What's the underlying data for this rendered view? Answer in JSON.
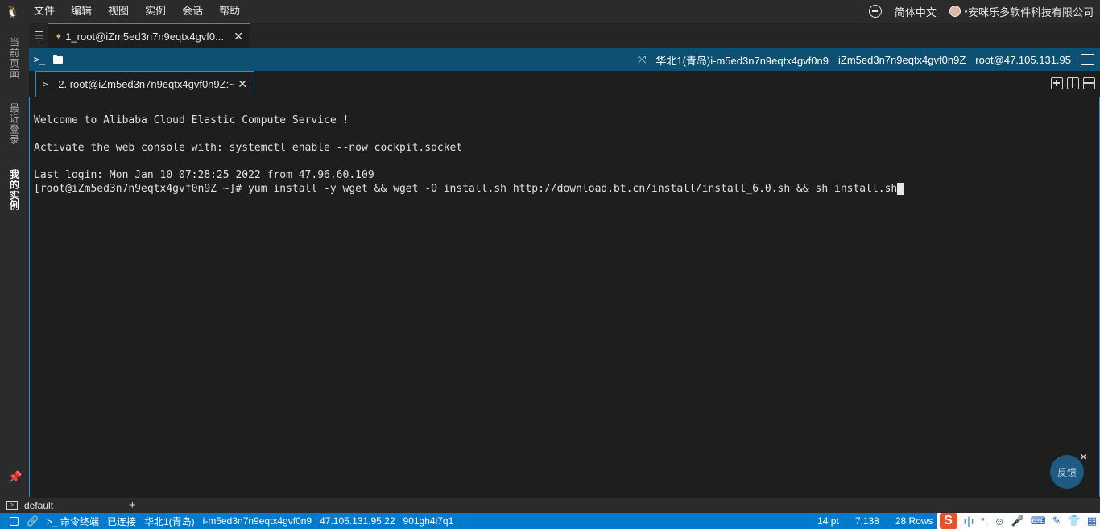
{
  "menubar": {
    "items": [
      "文件",
      "编辑",
      "视图",
      "实例",
      "会话",
      "帮助"
    ],
    "language": "简体中文",
    "account": "*安咪乐多软件科技有限公司"
  },
  "sidebar": {
    "tabs": [
      {
        "label": "当前页面",
        "icon": "refresh-icon"
      },
      {
        "label": "最近登录",
        "icon": "clock-icon"
      },
      {
        "label": "我的实例",
        "icon": "server-icon"
      }
    ]
  },
  "session_tab": {
    "label": "1_root@iZm5ed3n7n9eqtx4gvf0..."
  },
  "infobar": {
    "region": "华北1(青岛)i-m5ed3n7n9eqtx4gvf0n9",
    "hostname": "iZm5ed3n7n9eqtx4gvf0n9Z",
    "user_ip": "root@47.105.131.95"
  },
  "terminal_tab": {
    "label": "2. root@iZm5ed3n7n9eqtx4gvf0n9Z:~"
  },
  "terminal": {
    "lines": [
      "Welcome to Alibaba Cloud Elastic Compute Service !",
      "",
      "Activate the web console with: systemctl enable --now cockpit.socket",
      "",
      "Last login: Mon Jan 10 07:28:25 2022 from 47.96.60.109",
      "[root@iZm5ed3n7n9eqtx4gvf0n9Z ~]# yum install -y wget && wget -O install.sh http://download.bt.cn/install/install_6.0.sh && sh install.sh"
    ]
  },
  "feedback": {
    "label": "反馈"
  },
  "panel": {
    "tab_label": "default"
  },
  "statusbar": {
    "mode": "命令终端",
    "connection": "已连接",
    "region": "华北1(青岛)",
    "instance": "i-m5ed3n7n9eqtx4gvf0n9",
    "address": "47.105.131.95:22",
    "code": "901gh4i7q1",
    "font_size": "14 pt",
    "cursor_pos": "7,138",
    "rows": "28 Rows"
  },
  "ime": {
    "lang": "中",
    "punct": "°,"
  },
  "colors": {
    "accent": "#1797d3",
    "infobar": "#0e5071",
    "statusbar": "#007acc"
  }
}
